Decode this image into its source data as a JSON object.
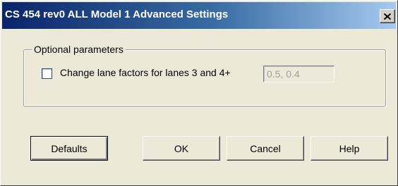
{
  "window": {
    "title": "CS 454 rev0 ALL Model 1 Advanced Settings",
    "close_glyph": "✕"
  },
  "optional_parameters": {
    "legend": "Optional parameters",
    "change_lane_factors": {
      "label": "Change lane factors for lanes 3 and 4+",
      "checked": false
    },
    "lane_factors_value": "0.5, 0.4"
  },
  "buttons": {
    "defaults": "Defaults",
    "ok": "OK",
    "cancel": "Cancel",
    "help": "Help"
  },
  "icons": {
    "close": "close-icon"
  },
  "colors": {
    "titlebar_start": "#0a246a",
    "titlebar_end": "#a6caf0",
    "dialog_background": "#ece9d8",
    "disabled_text": "#a0a0a0"
  }
}
